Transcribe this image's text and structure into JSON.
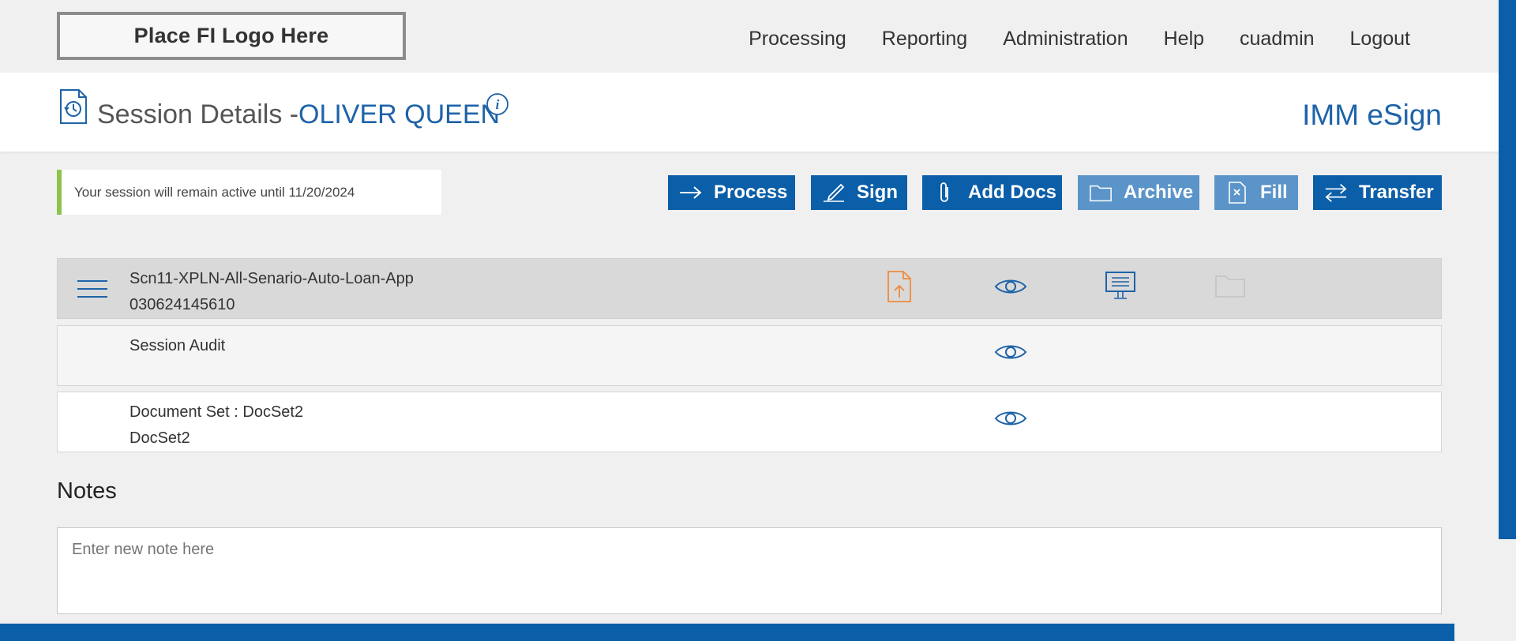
{
  "logo": {
    "text": "Place FI Logo Here"
  },
  "nav": {
    "processing": "Processing",
    "reporting": "Reporting",
    "administration": "Administration",
    "help": "Help",
    "user": "cuadmin",
    "logout": "Logout"
  },
  "header": {
    "title": "Session Details -",
    "name": "OLIVER QUEEN",
    "brand": "IMM eSign"
  },
  "notice": {
    "text": "Your session will remain active until 11/20/2024"
  },
  "actions": {
    "process": "Process",
    "sign": "Sign",
    "add_docs": "Add Docs",
    "archive": "Archive",
    "fill": "Fill",
    "transfer": "Transfer"
  },
  "rows": [
    {
      "line1": "Scn11-XPLN-All-Senario-Auto-Loan-App",
      "line2": "030624145610"
    },
    {
      "line1": "Session Audit",
      "line2": ""
    },
    {
      "line1": "Document Set : DocSet2",
      "line2": "DocSet2"
    }
  ],
  "notes": {
    "title": "Notes",
    "placeholder": "Enter new note here"
  },
  "colors": {
    "primary": "#0b5ea8",
    "accent_orange": "#f08a3c",
    "notice_green": "#8cc44a",
    "disabled_button": "#5b94c8"
  }
}
